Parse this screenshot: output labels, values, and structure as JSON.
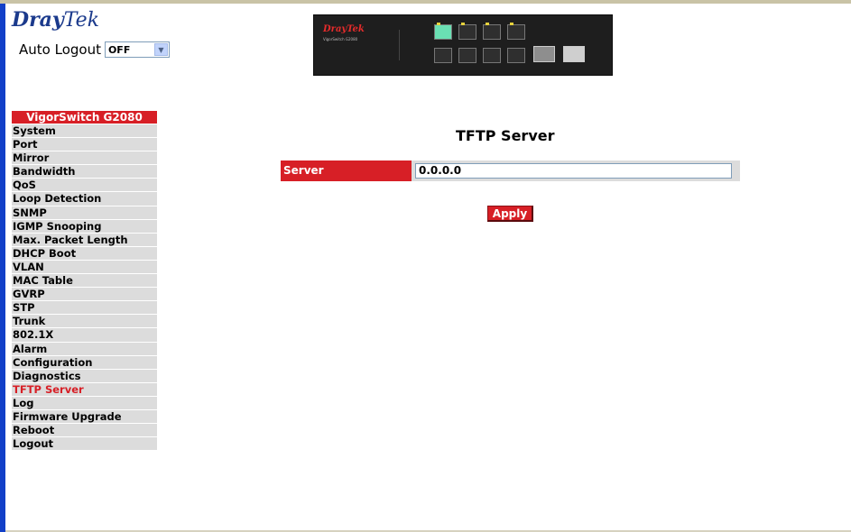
{
  "brand": {
    "logo_part1": "Dray",
    "logo_part2": "Tek"
  },
  "auto_logout": {
    "label": "Auto Logout",
    "value": "OFF"
  },
  "device_image": {
    "brand": "DrayTek",
    "model": "VigorSwitch G2080"
  },
  "sidebar": {
    "header": "VigorSwitch G2080",
    "items": [
      {
        "label": "System"
      },
      {
        "label": "Port"
      },
      {
        "label": "Mirror"
      },
      {
        "label": "Bandwidth"
      },
      {
        "label": "QoS"
      },
      {
        "label": "Loop Detection"
      },
      {
        "label": "SNMP"
      },
      {
        "label": "IGMP Snooping"
      },
      {
        "label": "Max. Packet Length"
      },
      {
        "label": "DHCP Boot"
      },
      {
        "label": "VLAN"
      },
      {
        "label": "MAC Table"
      },
      {
        "label": "GVRP"
      },
      {
        "label": "STP"
      },
      {
        "label": "Trunk"
      },
      {
        "label": "802.1X"
      },
      {
        "label": "Alarm"
      },
      {
        "label": "Configuration"
      },
      {
        "label": "Diagnostics"
      },
      {
        "label": "TFTP Server",
        "active": true
      },
      {
        "label": "Log"
      },
      {
        "label": "Firmware Upgrade"
      },
      {
        "label": "Reboot"
      },
      {
        "label": "Logout"
      }
    ]
  },
  "main": {
    "title": "TFTP Server",
    "server_label": "Server",
    "server_value": "0.0.0.0",
    "apply_label": "Apply"
  },
  "colors": {
    "accent_red": "#d71f26",
    "sidebar_gray": "#dcdcdc",
    "left_stripe": "#1240c8"
  }
}
